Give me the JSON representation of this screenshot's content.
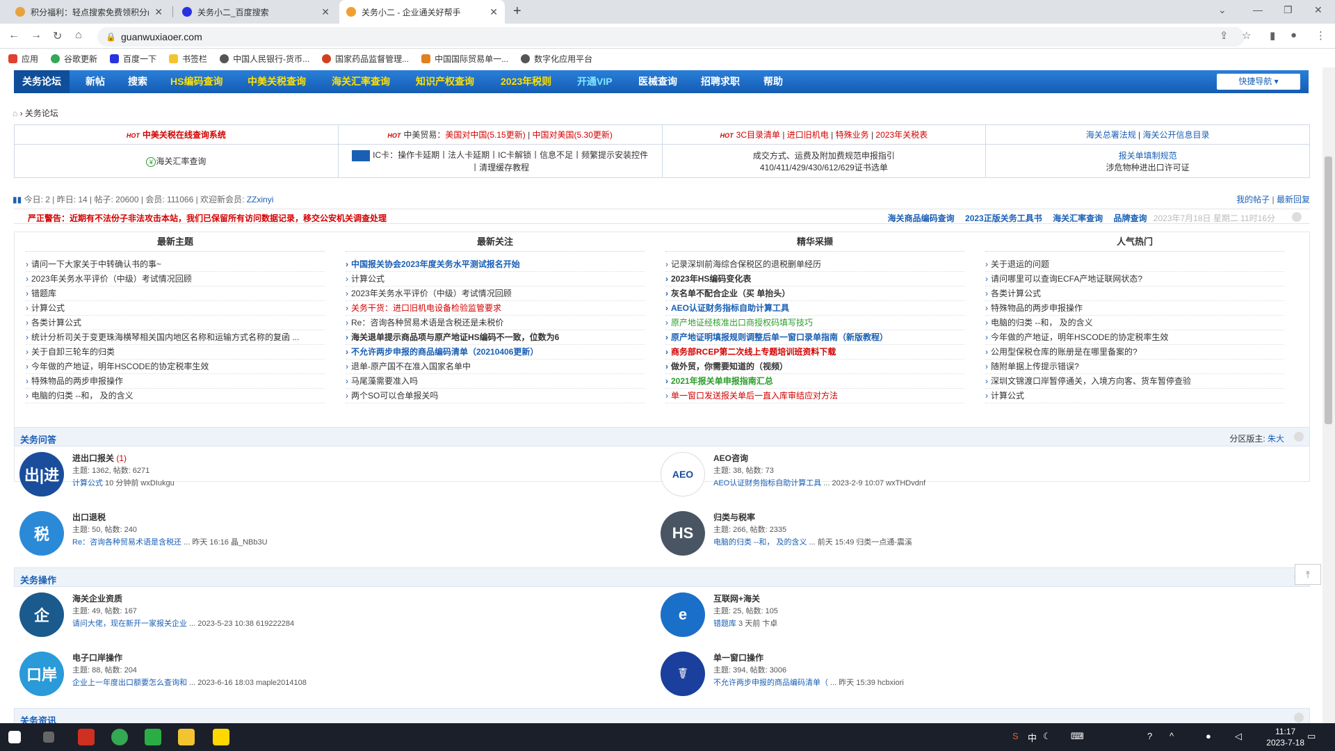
{
  "browser": {
    "tabs": [
      {
        "title": "积分福利：轻点搜索免费领积分(",
        "active": false
      },
      {
        "title": "关务小二_百度搜索",
        "active": false
      },
      {
        "title": "关务小二 - 企业通关好帮手",
        "active": true
      }
    ],
    "url": "guanwuxiaoer.com",
    "bookmarks": [
      "应用",
      "谷歌更新",
      "百度一下",
      "书签栏",
      "中国人民银行-货币...",
      "国家药品监督管理...",
      "中国国际贸易单一...",
      "数字化应用平台"
    ]
  },
  "nav": {
    "items": [
      {
        "label": "关务论坛",
        "yellow": false
      },
      {
        "label": "新帖",
        "yellow": false
      },
      {
        "label": "搜索",
        "yellow": false
      },
      {
        "label": "HS编码查询",
        "yellow": true
      },
      {
        "label": "中美关税查询",
        "yellow": true
      },
      {
        "label": "海关汇率查询",
        "yellow": true
      },
      {
        "label": "知识产权查询",
        "yellow": true
      },
      {
        "label": "2023年税则",
        "yellow": true
      },
      {
        "label": "开通VIP",
        "yellow": false
      },
      {
        "label": "医械查询",
        "yellow": false
      },
      {
        "label": "招聘求职",
        "yellow": false
      },
      {
        "label": "帮助",
        "yellow": false
      }
    ],
    "quick": "快捷导航"
  },
  "breadcrumb": "关务论坛",
  "top_links": {
    "r1c1": "中美关税在线查询系统",
    "r1c2_prefix": "中美贸易：",
    "r1c2_a": "美国对中国(5.15更新)",
    "r1c2_b": "中国对美国(5.30更新)",
    "r1c3": [
      "3C目录清单",
      "进口旧机电",
      "特殊业务",
      "2023年关税表"
    ],
    "r1c4": [
      "海关总署法规",
      "海关公开信息目录"
    ],
    "r2c1": "海关汇率查询",
    "r2c2_line1": "IC卡：操作卡延期丨法人卡延期丨IC卡解锁丨信息不足丨频繁提示安装控件",
    "r2c2_line2": "丨清理缓存教程",
    "r2c3_line1": "成交方式、运费及附加费规范申报指引",
    "r2c3_line2": "410/411/429/430/612/629证书选单",
    "r2c4_line1": "报关单填制规范",
    "r2c4_line2": "涉危物种进出口许可证"
  },
  "stats": {
    "text": "今日: 2 | 昨日: 14 | 帖子: 20600 | 会员: 111066 | 欢迎新会员: ",
    "newest": "ZZxinyi",
    "my_posts": "我的帖子",
    "latest_reply": "最新回复"
  },
  "warning": "严正警告：近期有不法份子非法攻击本站，我们已保留所有访问数据记录，移交公安机关调查处理",
  "right_links": [
    "海关商品编码查询",
    "2023正版关务工具书",
    "海关汇率查询",
    "品牌查询"
  ],
  "date_text": "2023年7月18日 星期二 11时16分",
  "columns": [
    {
      "title": "最新主题",
      "items": [
        {
          "t": "请问一下大家关于中转确认书的事~",
          "s": ""
        },
        {
          "t": "2023年关务水平评价（中级）考试情况回顾",
          "s": ""
        },
        {
          "t": "错题库",
          "s": ""
        },
        {
          "t": "计算公式",
          "s": ""
        },
        {
          "t": "各类计算公式",
          "s": ""
        },
        {
          "t": "统计分析司关于变更珠海横琴相关国内地区名称和运输方式名称的复函 ...",
          "s": ""
        },
        {
          "t": "关于自卸三轮车的归类",
          "s": ""
        },
        {
          "t": "今年做的产地证，明年HSCODE的协定税率生效",
          "s": ""
        },
        {
          "t": "特殊物品的两步申报操作",
          "s": ""
        },
        {
          "t": "电脑的归类 --和， 及的含义",
          "s": ""
        }
      ]
    },
    {
      "title": "最新关注",
      "items": [
        {
          "t": "中国报关协会2023年度关务水平测试报名开始",
          "s": "blue b"
        },
        {
          "t": "计算公式",
          "s": ""
        },
        {
          "t": "2023年关务水平评价（中级）考试情况回顾",
          "s": ""
        },
        {
          "t": "关务干货：进口旧机电设备检验监管要求",
          "s": "red"
        },
        {
          "t": "Re：咨询各种贸易术语是含税还是未税价",
          "s": ""
        },
        {
          "t": "海关退单提示商品项与原产地证HS编码不一致，位数为6",
          "s": "b"
        },
        {
          "t": "不允许两步申报的商品编码清单（20210406更新）",
          "s": "blue b"
        },
        {
          "t": "退单-原产国不在准入国家名单中",
          "s": ""
        },
        {
          "t": "马尾藻需要准入吗",
          "s": ""
        },
        {
          "t": "两个SO可以合单报关吗",
          "s": ""
        }
      ]
    },
    {
      "title": "精华采撷",
      "items": [
        {
          "t": "记录深圳前海综合保税区的退税删单经历",
          "s": ""
        },
        {
          "t": "2023年HS编码变化表",
          "s": "b"
        },
        {
          "t": "灰名单不配合企业（买 单抬头）",
          "s": "b"
        },
        {
          "t": "AEO认证财务指标自助计算工具",
          "s": "blue b"
        },
        {
          "t": "原产地证经核准出口商授权码填写技巧",
          "s": "g"
        },
        {
          "t": "原产地证明填报规则调整后单一窗口录单指南（新版教程）",
          "s": "blue b"
        },
        {
          "t": "商务部RCEP第二次线上专题培训班资料下载",
          "s": "red b"
        },
        {
          "t": "做外贸，你需要知道的（视频）",
          "s": "b"
        },
        {
          "t": "2021年报关单申报指南汇总",
          "s": "g b"
        },
        {
          "t": "单一窗口发送报关单后一直入库审结应对方法",
          "s": "red"
        }
      ]
    },
    {
      "title": "人气热门",
      "items": [
        {
          "t": "关于退运的问题",
          "s": ""
        },
        {
          "t": "请问哪里可以查询ECFA产地证联网状态?",
          "s": ""
        },
        {
          "t": "各类计算公式",
          "s": ""
        },
        {
          "t": "特殊物品的两步申报操作",
          "s": ""
        },
        {
          "t": "电脑的归类 --和， 及的含义",
          "s": ""
        },
        {
          "t": "今年做的产地证，明年HSCODE的协定税率生效",
          "s": ""
        },
        {
          "t": "公用型保税仓库的账册是在哪里备案的?",
          "s": ""
        },
        {
          "t": "随附单据上传提示错误?",
          "s": ""
        },
        {
          "t": "深圳文锦渡口岸暂停通关，入境方向客、货车暂停查验",
          "s": ""
        },
        {
          "t": "计算公式",
          "s": ""
        }
      ]
    }
  ],
  "section1": {
    "title": "关务问答",
    "moderator_label": "分区版主: ",
    "moderator": "朱大",
    "forums": [
      {
        "icon": "出|进",
        "color": "#1a4d9c",
        "name": "进出口报关",
        "new": "(1)",
        "stat": "主题: 1362, 帖数: 6271",
        "last_link": "计算公式",
        "last_meta": " 10 分钟前 wxDIukgu"
      },
      {
        "icon": "AEO",
        "color": "#ffffff",
        "name": "AEO咨询",
        "new": "",
        "stat": "主题: 38, 帖数: 73",
        "last_link": "AEO认证财务指标自助计算工具",
        "last_meta": " ... 2023-2-9 10:07 wxTHDvdnf"
      },
      {
        "icon": "税",
        "color": "#2a8ad8",
        "name": "出口退税",
        "new": "",
        "stat": "主题: 50, 帖数: 240",
        "last_link": "Re：咨询各种贸易术语是含税还",
        "last_meta": " ... 昨天 16:16 晶_NBb3U"
      },
      {
        "icon": "HS",
        "color": "#4a5563",
        "name": "归类与税率",
        "new": "",
        "stat": "主题: 266, 帖数: 2335",
        "last_link": "电脑的归类 --和， 及的含义",
        "last_meta": " ... 前天 15:49 归类一点通-震溪"
      }
    ]
  },
  "section2": {
    "title": "关务操作",
    "forums": [
      {
        "icon": "企",
        "color": "#1a5a8c",
        "name": "海关企业资质",
        "new": "",
        "stat": "主题: 49, 帖数: 167",
        "last_link": "请问大佬，现在新开一家报关企业",
        "last_meta": " ... 2023-5-23 10:38 619222284"
      },
      {
        "icon": "e",
        "color": "#1a6fc9",
        "name": "互联网+海关",
        "new": "",
        "stat": "主题: 25, 帖数: 105",
        "last_link": "错题库",
        "last_meta": " 3 天前 卞卓"
      },
      {
        "icon": "口岸",
        "color": "#2a9ad8",
        "name": "电子口岸操作",
        "new": "",
        "stat": "主题: 88, 帖数: 204",
        "last_link": "企业上一年度出口额要怎么查询和",
        "last_meta": " ... 2023-6-16 18:03 maple2014108"
      },
      {
        "icon": "☤",
        "color": "#1a3f9c",
        "name": "单一窗口操作",
        "new": "",
        "stat": "主题: 394, 帖数: 3006",
        "last_link": "不允许两步申报的商品编码清单（",
        "last_meta": " ... 昨天 15:39 hcbxiori"
      }
    ]
  },
  "section3": {
    "title": "关务资讯"
  },
  "taskbar": {
    "time": "11:17",
    "date": "2023-7-18",
    "ime": "中"
  },
  "colors": {
    "nav_blue": "#1a6fc9",
    "nav_yellow": "#ffe000",
    "warn_red": "#d40000",
    "link_blue": "#1a5fb4"
  }
}
